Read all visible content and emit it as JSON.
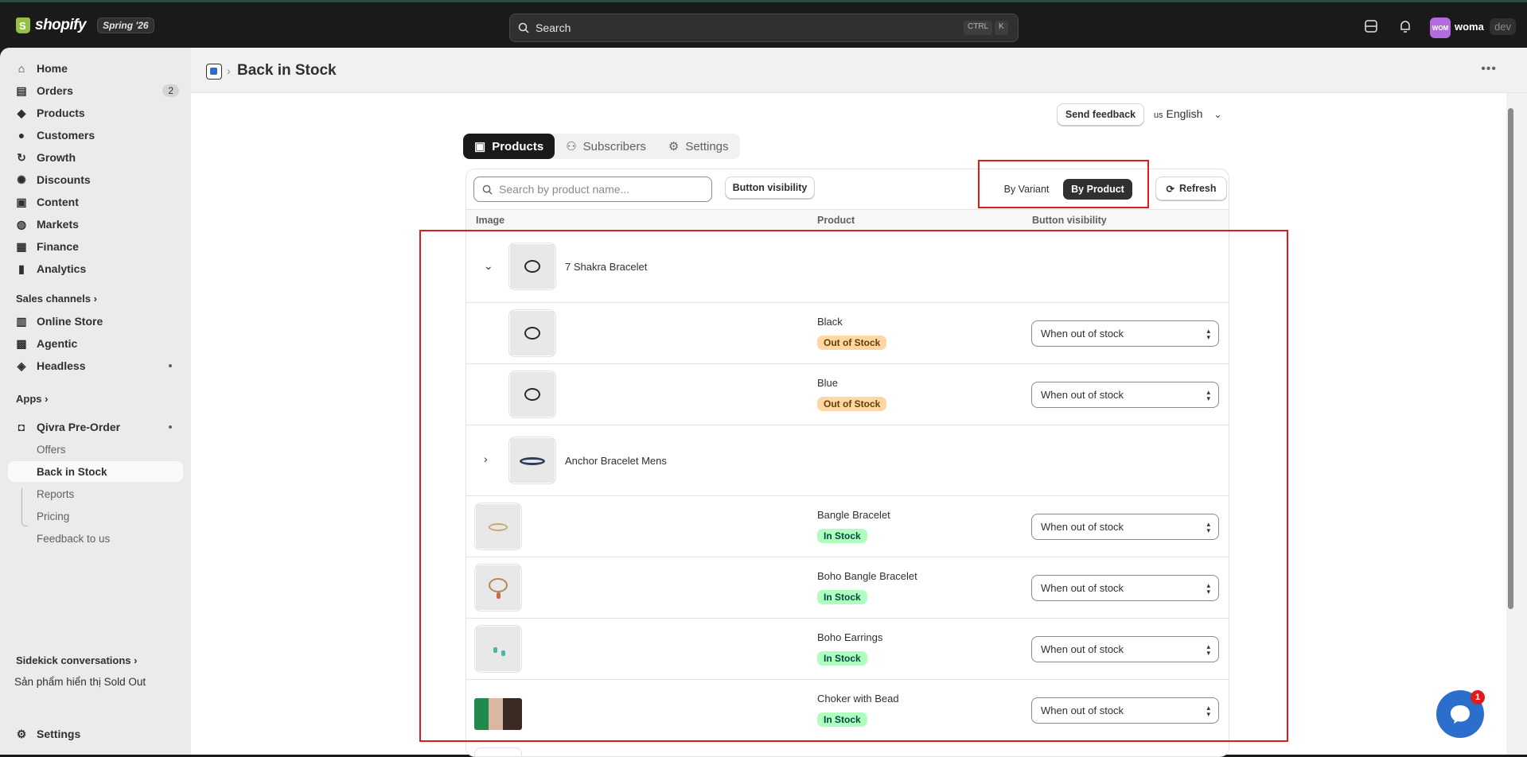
{
  "topbar": {
    "brand": "shopify",
    "edition": "Spring '26",
    "search_placeholder": "Search",
    "kbd_ctrl": "CTRL",
    "kbd_k": "K",
    "avatar_initials": "WOM",
    "store_name": "woma",
    "env_badge": "dev"
  },
  "sidebar": {
    "items": [
      {
        "label": "Home",
        "icon": "home-icon"
      },
      {
        "label": "Orders",
        "icon": "inbox-icon",
        "badge": "2"
      },
      {
        "label": "Products",
        "icon": "tag-icon"
      },
      {
        "label": "Customers",
        "icon": "person-icon"
      },
      {
        "label": "Growth",
        "icon": "growth-icon"
      },
      {
        "label": "Discounts",
        "icon": "discount-icon"
      },
      {
        "label": "Content",
        "icon": "content-icon"
      },
      {
        "label": "Markets",
        "icon": "globe-icon"
      },
      {
        "label": "Finance",
        "icon": "bank-icon"
      },
      {
        "label": "Analytics",
        "icon": "bar-chart-icon"
      }
    ],
    "sales_channels_label": "Sales channels",
    "channels": [
      {
        "label": "Online Store",
        "icon": "store-icon"
      },
      {
        "label": "Agentic",
        "icon": "agent-icon"
      },
      {
        "label": "Headless",
        "icon": "layers-icon"
      }
    ],
    "apps_label": "Apps",
    "app_name": "Qivra Pre-Order",
    "app_subitems": [
      "Offers",
      "Back in Stock",
      "Reports",
      "Pricing",
      "Feedback to us"
    ],
    "sidekick_label": "Sidekick conversations",
    "sidekick_item": "Sản phẩm hiển thị Sold Out",
    "settings_label": "Settings"
  },
  "header": {
    "page_title": "Back in Stock"
  },
  "toolbar": {
    "feedback_label": "Send feedback",
    "language_flag": "us",
    "language_label": "English"
  },
  "tabs": [
    "Products",
    "Subscribers",
    "Settings"
  ],
  "filters": {
    "search_placeholder": "Search by product name...",
    "button_visibility_label": "Button visibility",
    "view_by_variant": "By Variant",
    "view_by_product": "By Product",
    "refresh_label": "Refresh"
  },
  "table": {
    "columns": [
      "Image",
      "Product",
      "Button visibility"
    ],
    "rows": [
      {
        "type": "group",
        "expanded": true,
        "name": "7 Shakra Bracelet"
      },
      {
        "type": "variant",
        "name": "Black",
        "status": "Out of Stock",
        "visibility": "When out of stock"
      },
      {
        "type": "variant",
        "name": "Blue",
        "status": "Out of Stock",
        "visibility": "When out of stock"
      },
      {
        "type": "group",
        "expanded": false,
        "name": "Anchor Bracelet Mens"
      },
      {
        "type": "product",
        "name": "Bangle Bracelet",
        "status": "In Stock",
        "visibility": "When out of stock"
      },
      {
        "type": "product",
        "name": "Boho Bangle Bracelet",
        "status": "In Stock",
        "visibility": "When out of stock"
      },
      {
        "type": "product",
        "name": "Boho Earrings",
        "status": "In Stock",
        "visibility": "When out of stock"
      },
      {
        "type": "product",
        "name": "Choker with Bead",
        "status": "In Stock",
        "visibility": "When out of stock"
      }
    ]
  },
  "chat": {
    "badge_count": "1"
  },
  "colors": {
    "accent": "#303030",
    "highlight_box": "#e11b1b",
    "out_of_stock_bg": "#ffd6a4",
    "in_stock_bg": "#affebf"
  }
}
